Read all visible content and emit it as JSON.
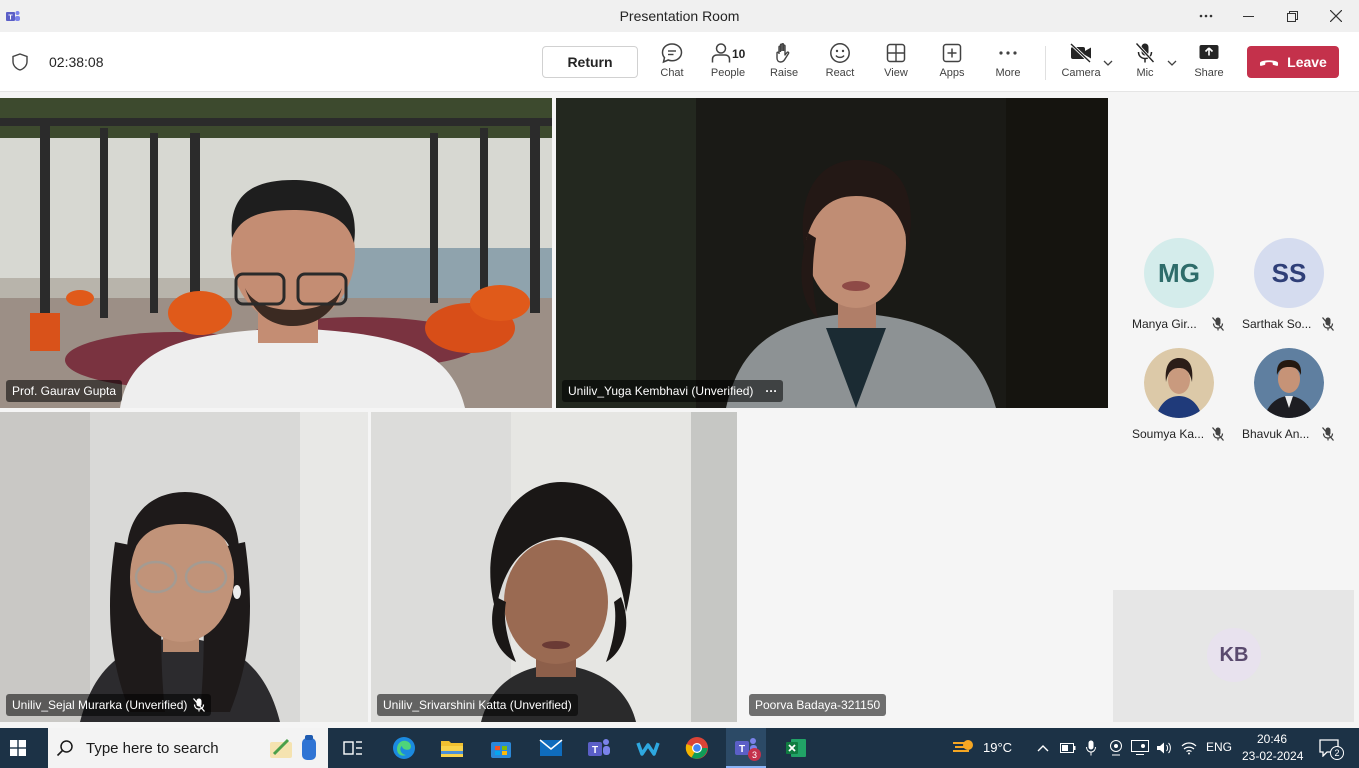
{
  "window": {
    "title": "Presentation Room"
  },
  "toolbar": {
    "timer": "02:38:08",
    "return_label": "Return",
    "chat_label": "Chat",
    "people_label": "People",
    "people_count": "10",
    "raise_label": "Raise",
    "react_label": "React",
    "view_label": "View",
    "apps_label": "Apps",
    "more_label": "More",
    "camera_label": "Camera",
    "mic_label": "Mic",
    "share_label": "Share",
    "leave_label": "Leave"
  },
  "tiles": [
    {
      "name": "Prof. Gaurav Gupta"
    },
    {
      "name": "Uniliv_Yuga Kembhavi (Unverified)",
      "more": "···"
    },
    {
      "name": "Uniliv_Sejal Murarka (Unverified)"
    },
    {
      "name": "Uniliv_Srivarshini Katta (Unverified)"
    },
    {
      "name": "Poorva Badaya-321150"
    }
  ],
  "roster": [
    {
      "initials": "MG",
      "name": "Manya Gir..."
    },
    {
      "initials": "SS",
      "name": "Sarthak So..."
    },
    {
      "initials": "",
      "name": "Soumya Ka..."
    },
    {
      "initials": "",
      "name": "Bhavuk An..."
    }
  ],
  "self_view": {
    "initials": "KB"
  },
  "taskbar": {
    "search_placeholder": "Type here to search",
    "temperature": "19°C",
    "language": "ENG",
    "time": "20:46",
    "date": "23-02-2024",
    "teams_badge": "3",
    "notification_count": "2"
  },
  "colors": {
    "accent": "#6264a7",
    "leave": "#c4314b"
  }
}
